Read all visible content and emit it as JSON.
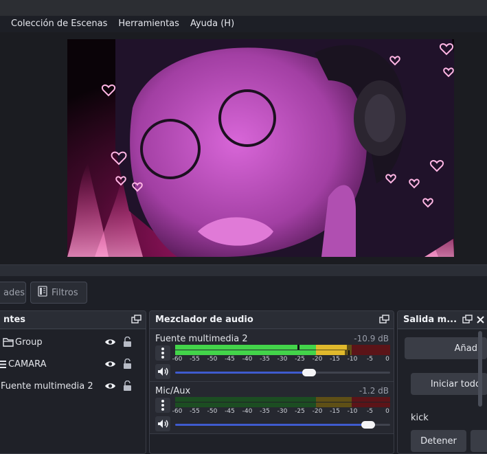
{
  "menu": {
    "items": [
      "Colección de Escenas",
      "Herramientas",
      "Ayuda (H)"
    ]
  },
  "controls": {
    "properties_label": "ades",
    "filters_label": "Filtros"
  },
  "sources": {
    "title": "ntes",
    "items": [
      {
        "label": "Group",
        "icon": "folder-icon"
      },
      {
        "label": "CAMARA",
        "icon": "list-icon"
      },
      {
        "label": "Fuente multimedia 2",
        "icon": "media-icon"
      }
    ]
  },
  "mixer": {
    "title": "Mezclador de audio",
    "channels": [
      {
        "name": "Fuente multimedia 2",
        "db": "-10.9 dB",
        "level": 0.72
      },
      {
        "name": "Mic/Aux",
        "db": "-1.2 dB",
        "level": 0.98
      }
    ],
    "ticks": [
      "-60",
      "-55",
      "-50",
      "-45",
      "-40",
      "-35",
      "-30",
      "-25",
      "-20",
      "-15",
      "-10",
      "-5",
      "0"
    ]
  },
  "output": {
    "title": "Salida m...",
    "add_label": "Añad",
    "start_all_label": "Iniciar todo",
    "target_label": "kick",
    "stop_label": "Detener"
  },
  "colors": {
    "accent": "#3f5bcf",
    "meter_green": "#43d44a",
    "meter_yellow": "#e0b92c",
    "meter_red": "#c42d35"
  }
}
